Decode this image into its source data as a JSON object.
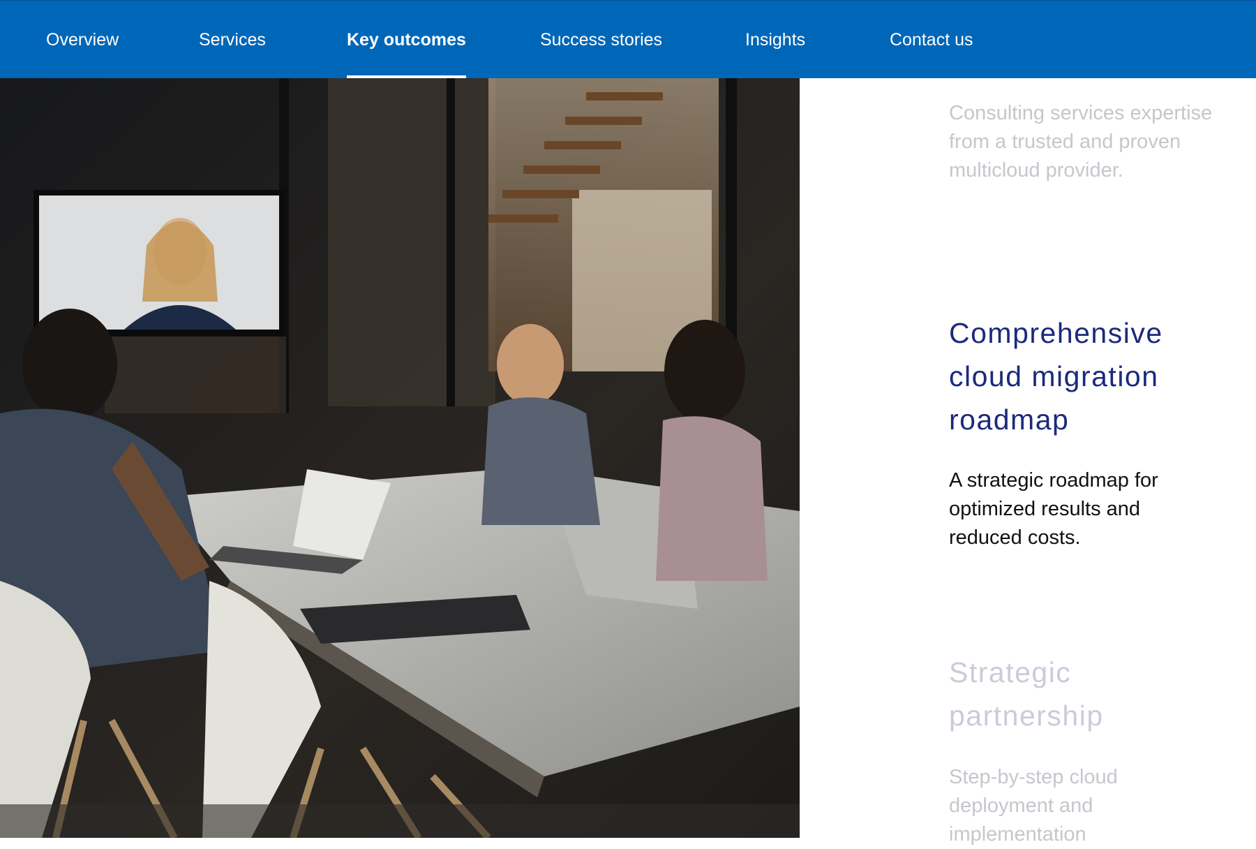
{
  "nav": {
    "tabs": [
      {
        "label": "Overview"
      },
      {
        "label": "Services"
      },
      {
        "label": "Key outcomes"
      },
      {
        "label": "Success stories"
      },
      {
        "label": "Insights"
      },
      {
        "label": "Contact us"
      }
    ],
    "active_tab": "Key outcomes",
    "background": "#0067b8"
  },
  "hero": {
    "image": "photo-meeting-room-video-conference"
  },
  "outcomes": {
    "previous_body": "Consulting services expertise from a trusted and proven multicloud provider.",
    "current_heading": "Comprehensive cloud migration roadmap",
    "current_body": "A strategic roadmap for optimized results and reduced costs.",
    "next_heading": "Strategic partnership",
    "next_body": "Step-by-step cloud deployment and implementation"
  },
  "colors": {
    "heading": "#1a2a7c",
    "body": "#111111",
    "faded": "#c4c7cc"
  }
}
